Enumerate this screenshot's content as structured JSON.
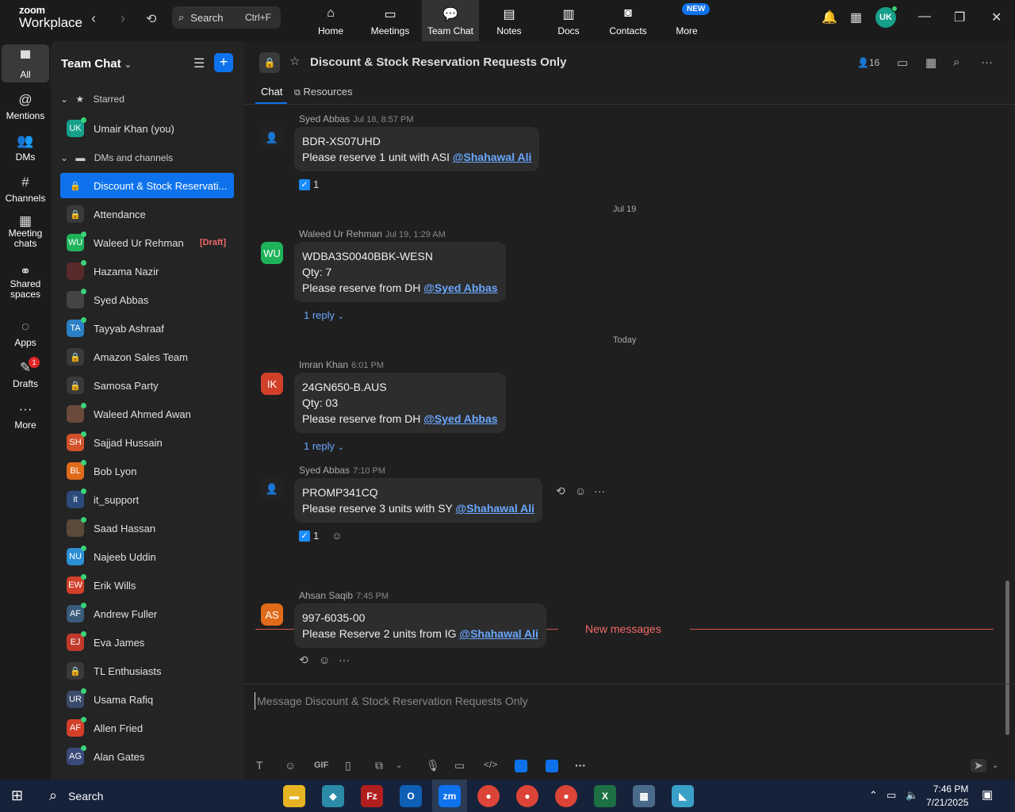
{
  "topbar": {
    "logo_line1": "zoom",
    "logo_line2": "Workplace",
    "search_label": "Search",
    "search_shortcut": "Ctrl+F",
    "tabs": [
      {
        "label": "Home",
        "icon": "home-icon"
      },
      {
        "label": "Meetings",
        "icon": "video-icon"
      },
      {
        "label": "Team Chat",
        "icon": "chat-icon"
      },
      {
        "label": "Notes",
        "icon": "notes-icon"
      },
      {
        "label": "Docs",
        "icon": "docs-icon"
      },
      {
        "label": "Contacts",
        "icon": "contacts-icon"
      },
      {
        "label": "More",
        "icon": "more-icon"
      }
    ],
    "new_badge": "NEW",
    "user_initials": "UK"
  },
  "rail": {
    "items": [
      {
        "label": "All",
        "glyph": "▀"
      },
      {
        "label": "Mentions",
        "glyph": "@"
      },
      {
        "label": "DMs",
        "glyph": "👥"
      },
      {
        "label": "Channels",
        "glyph": "#"
      },
      {
        "label": "Meeting chats",
        "glyph": "▦"
      },
      {
        "label": "Shared spaces",
        "glyph": "⚭"
      },
      {
        "label": "Apps",
        "glyph": "◌"
      },
      {
        "label": "Drafts",
        "glyph": "✎"
      },
      {
        "label": "More",
        "glyph": "···"
      }
    ],
    "drafts_count": "1"
  },
  "sidebar": {
    "title": "Team Chat",
    "starred_label": "Starred",
    "dms_label": "DMs and channels",
    "starred": [
      {
        "name": "Umair Khan (you)",
        "initials": "UK",
        "color": "#16a08b"
      }
    ],
    "items": [
      {
        "name": "Discount & Stock Reservati...",
        "initials": "🔒",
        "color": "#0e72ed",
        "lock": true
      },
      {
        "name": "Attendance",
        "initials": "🔒",
        "color": "#3a3a3a",
        "lock": true
      },
      {
        "name": "Waleed Ur Rehman",
        "initials": "WU",
        "color": "#1eb35a",
        "draft": "[Draft]"
      },
      {
        "name": "Hazama Nazir",
        "initials": "",
        "color": "#5a2a2a"
      },
      {
        "name": "Syed Abbas",
        "initials": "",
        "color": "#444"
      },
      {
        "name": "Tayyab Ashraaf",
        "initials": "TA",
        "color": "#2b7fc4"
      },
      {
        "name": "Amazon Sales Team",
        "initials": "🔒",
        "color": "#3a3a3a",
        "lock": true
      },
      {
        "name": "Samosa Party",
        "initials": "🔒",
        "color": "#3a3a3a",
        "lock": true
      },
      {
        "name": "Waleed Ahmed Awan",
        "initials": "",
        "color": "#6a4a3a"
      },
      {
        "name": "Sajjad Hussain",
        "initials": "SH",
        "color": "#d2502a"
      },
      {
        "name": "Bob Lyon",
        "initials": "BL",
        "color": "#e06b1a"
      },
      {
        "name": "it_support",
        "initials": "it",
        "color": "#2c4a7a"
      },
      {
        "name": "Saad Hassan",
        "initials": "",
        "color": "#5a4a3a"
      },
      {
        "name": "Najeeb Uddin",
        "initials": "NU",
        "color": "#2b8fd4"
      },
      {
        "name": "Erik Wills",
        "initials": "EW",
        "color": "#d2402a"
      },
      {
        "name": "Andrew Fuller",
        "initials": "AF",
        "color": "#3a5a7a"
      },
      {
        "name": "Eva James",
        "initials": "EJ",
        "color": "#c0392b"
      },
      {
        "name": "TL Enthusiasts",
        "initials": "🔒",
        "color": "#3a3a3a",
        "lock": true
      },
      {
        "name": "Usama Rafiq",
        "initials": "UR",
        "color": "#3a4a6a"
      },
      {
        "name": "Allen Fried",
        "initials": "AF",
        "color": "#d2402a"
      },
      {
        "name": "Alan Gates",
        "initials": "AG",
        "color": "#3a4a7a"
      }
    ]
  },
  "channel": {
    "title": "Discount & Stock Reservation Requests Only",
    "members": "16",
    "tabs": [
      "Chat",
      "Resources"
    ]
  },
  "messages": [
    {
      "sender": "Syed Abbas",
      "time": "Jul 18, 8:57 PM",
      "lines": [
        "BDR-XS07UHD",
        "Please reserve 1 unit with ASI "
      ],
      "mention": "@Shahawal Ali",
      "reaction": "1",
      "initials": "",
      "color": "#222"
    },
    {
      "sender": "Waleed Ur Rehman",
      "time": "Jul 19, 1:29 AM",
      "lines": [
        "WDBA3S0040BBK-WESN",
        "Qty: 7",
        "Please reserve from DH "
      ],
      "mention": "@Syed Abbas",
      "reply": "1 reply",
      "initials": "WU",
      "color": "#1eb35a"
    },
    {
      "sender": "Imran Khan",
      "time": "6:01 PM",
      "lines": [
        "24GN650-B.AUS",
        "Qty: 03",
        "Please reserve from DH "
      ],
      "mention": "@Syed Abbas",
      "reply": "1 reply",
      "initials": "IK",
      "color": "#d2402a"
    },
    {
      "sender": "Syed Abbas",
      "time": "7:10 PM",
      "lines": [
        "PROMP341CQ",
        "Please reserve 3 units with SY "
      ],
      "mention": "@Shahawal Ali",
      "reaction": "1",
      "initials": "",
      "color": "#222"
    },
    {
      "sender": "Ahsan Saqib",
      "time": "7:45 PM",
      "lines": [
        "997-6035-00",
        "Please Reserve 2 units from IG "
      ],
      "mention": "@Shahawal Ali",
      "initials": "AS",
      "color": "#e06b1a"
    }
  ],
  "date_separators": [
    "Jul 19",
    "Today"
  ],
  "new_messages_label": "New messages",
  "composer": {
    "placeholder": "Message Discount & Stock Reservation Requests Only"
  },
  "taskbar": {
    "search_label": "Search",
    "time": "7:46 PM",
    "date": "7/21/2025"
  }
}
